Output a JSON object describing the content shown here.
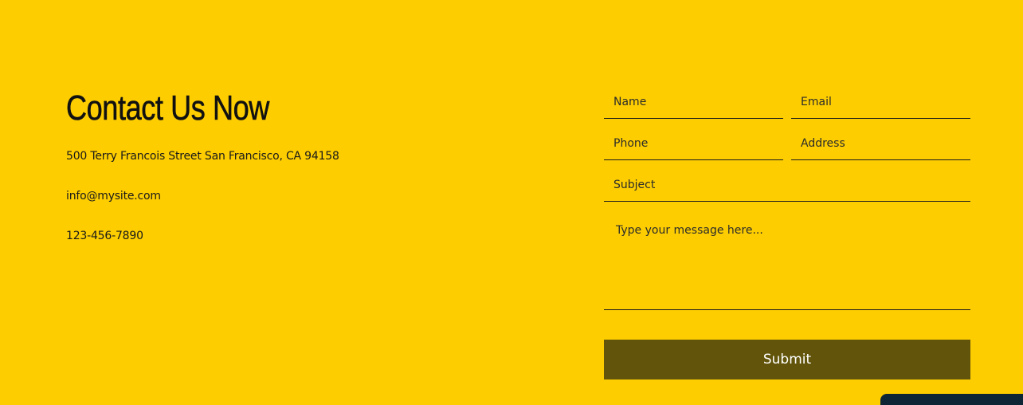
{
  "contact": {
    "heading": "Contact Us Now",
    "address": "500 Terry Francois Street San Francisco, CA 94158",
    "email": "info@mysite.com",
    "phone": "123-456-7890"
  },
  "form": {
    "name_placeholder": "Name",
    "email_placeholder": "Email",
    "phone_placeholder": "Phone",
    "address_placeholder": "Address",
    "subject_placeholder": "Subject",
    "message_placeholder": "Type your message here...",
    "submit_label": "Submit"
  },
  "colors": {
    "background": "#FDCD00",
    "submit_button": "#62550B",
    "submit_text": "#FFFFFF",
    "corner_widget": "#0E2535"
  }
}
